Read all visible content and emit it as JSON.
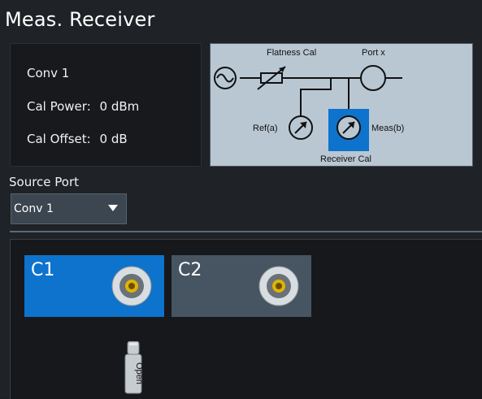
{
  "title": "Meas. Receiver",
  "info": {
    "converter": "Conv 1",
    "cal_power_label": "Cal Power:",
    "cal_power_value": "0 dBm",
    "cal_offset_label": "Cal Offset:",
    "cal_offset_value": "0 dB"
  },
  "diagram": {
    "flatness_cal": "Flatness Cal",
    "port_x": "Port x",
    "ref": "Ref(a)",
    "meas": "Meas(b)",
    "receiver_cal": "Receiver Cal"
  },
  "source_port": {
    "label": "Source Port",
    "selected": "Conv 1"
  },
  "ports": [
    {
      "label": "C1",
      "selected": true
    },
    {
      "label": "C2",
      "selected": false
    }
  ],
  "open_standard": "Open",
  "colors": {
    "accent": "#0d73cc",
    "diagram_bg": "#b9c7d3",
    "port_bg": "#465561",
    "connector_gold": "#e0b400"
  }
}
